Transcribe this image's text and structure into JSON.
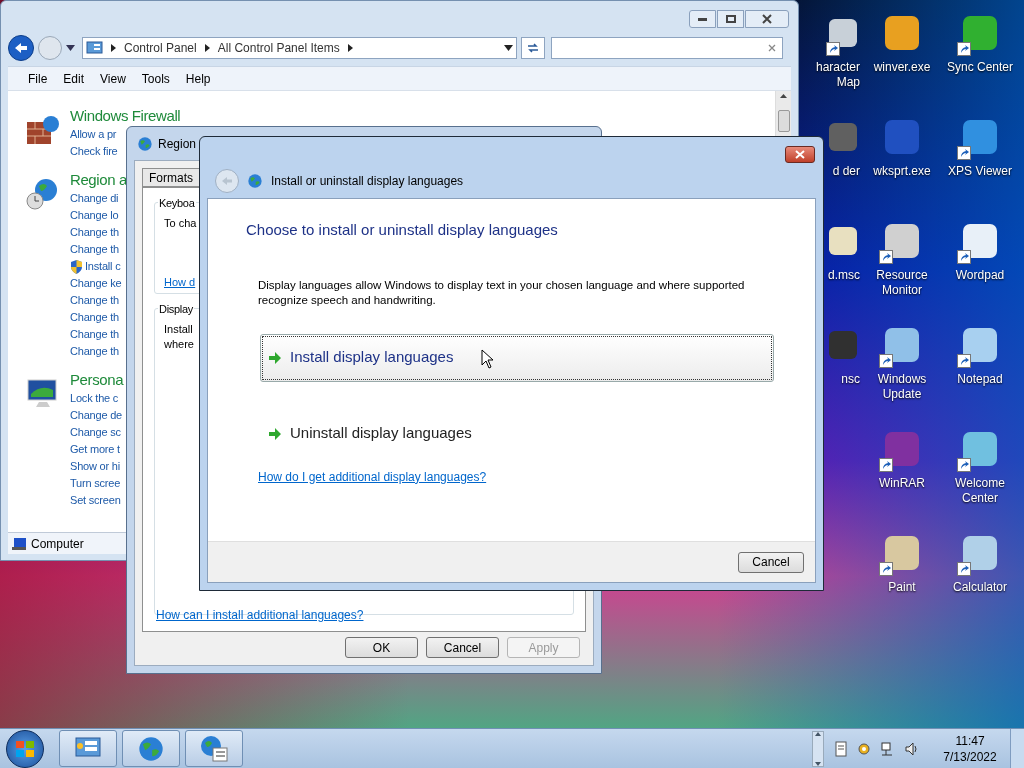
{
  "desktop": {
    "columns": [
      [
        {
          "label": "haracter Map",
          "shortcut": true,
          "color": "#c8d0d8"
        },
        {
          "label": "d der",
          "shortcut": false,
          "color": "#606060"
        },
        {
          "label": "d.msc",
          "shortcut": false,
          "color": "#e8e0c0"
        },
        {
          "label": "nsc",
          "shortcut": false,
          "color": "#303030"
        }
      ],
      [
        {
          "label": "winver.exe",
          "shortcut": false,
          "color": "#e8a020"
        },
        {
          "label": "wksprt.exe",
          "shortcut": false,
          "color": "#2050c0"
        },
        {
          "label": "Resource Monitor",
          "shortcut": true,
          "color": "#d0d0d0"
        },
        {
          "label": "Windows Update",
          "shortcut": true,
          "color": "#90c0e8"
        },
        {
          "label": "WinRAR",
          "shortcut": true,
          "color": "#8030a0"
        },
        {
          "label": "Paint",
          "shortcut": true,
          "color": "#d8c8a0"
        }
      ],
      [
        {
          "label": "Sync Center",
          "shortcut": true,
          "color": "#30b030"
        },
        {
          "label": "XPS Viewer",
          "shortcut": true,
          "color": "#3090e0"
        },
        {
          "label": "Wordpad",
          "shortcut": true,
          "color": "#e8f0f8"
        },
        {
          "label": "Notepad",
          "shortcut": true,
          "color": "#a8d0f0"
        },
        {
          "label": "Welcome Center",
          "shortcut": true,
          "color": "#70c0e0"
        },
        {
          "label": "Calculator",
          "shortcut": true,
          "color": "#b0d0e8"
        }
      ]
    ]
  },
  "explorer": {
    "breadcrumb": [
      "Control Panel",
      "All Control Panel Items"
    ],
    "menu": [
      "File",
      "Edit",
      "View",
      "Tools",
      "Help"
    ],
    "categories": [
      {
        "title": "Windows Firewall",
        "kind": "firewall",
        "links": [
          {
            "text": "Allow a pr",
            "shield": false
          },
          {
            "text": "Check fire",
            "shield": false
          }
        ]
      },
      {
        "title": "Region a",
        "kind": "region",
        "links": [
          {
            "text": "Change di",
            "shield": false
          },
          {
            "text": "Change lo",
            "shield": false
          },
          {
            "text": "Change th",
            "shield": false
          },
          {
            "text": "Change th",
            "shield": false
          },
          {
            "text": "Install c",
            "shield": true
          },
          {
            "text": "Change ke",
            "shield": false
          },
          {
            "text": "Change th",
            "shield": false
          },
          {
            "text": "Change th",
            "shield": false
          },
          {
            "text": "Change th",
            "shield": false
          },
          {
            "text": "Change th",
            "shield": false
          }
        ]
      },
      {
        "title": "Persona",
        "kind": "display",
        "links": [
          {
            "text": "Lock the c",
            "shield": false
          },
          {
            "text": "Change de",
            "shield": false
          },
          {
            "text": "Change sc",
            "shield": false
          },
          {
            "text": "Get more t",
            "shield": false
          },
          {
            "text": "Show or hi",
            "shield": false
          },
          {
            "text": "Turn scree",
            "shield": false
          },
          {
            "text": "Set screen",
            "shield": false
          }
        ]
      }
    ],
    "status": "Computer"
  },
  "region_dialog": {
    "title": "Region",
    "tabs": [
      {
        "label": "Formats",
        "selected": false
      }
    ],
    "groups": [
      {
        "title": "Keyboa",
        "lines": [
          "To cha"
        ],
        "link": "How d"
      },
      {
        "title": "Display",
        "lines": [
          "Install",
          "where"
        ]
      }
    ],
    "link": "How can I install additional languages?",
    "buttons": [
      {
        "label": "OK",
        "disabled": false
      },
      {
        "label": "Cancel",
        "disabled": false
      },
      {
        "label": "Apply",
        "disabled": true
      }
    ]
  },
  "install_dialog": {
    "title": "Install or uninstall display languages",
    "heading": "Choose to install or uninstall display languages",
    "description": "Display languages allow Windows to display text in your chosen language and where supported recognize speech and handwriting.",
    "options": [
      {
        "label": "Install display languages",
        "focused": true
      },
      {
        "label": "Uninstall display languages",
        "focused": false
      }
    ],
    "link": "How do I get additional display languages?",
    "buttons": [
      "Cancel"
    ]
  },
  "taskbar": {
    "tasks": [
      {
        "kind": "control-panel"
      },
      {
        "kind": "region"
      },
      {
        "kind": "languages"
      }
    ],
    "time": "11:47",
    "date": "7/13/2022"
  }
}
